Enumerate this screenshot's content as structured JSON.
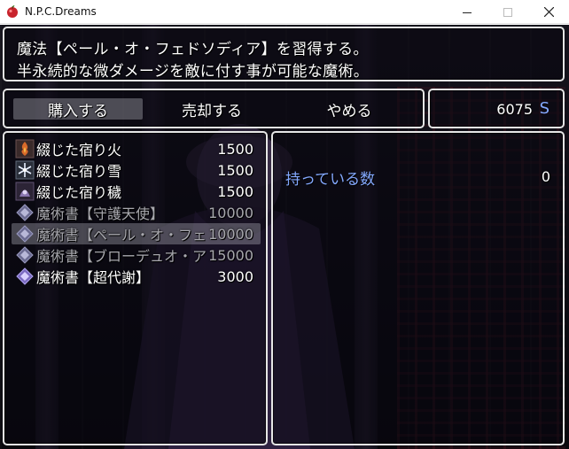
{
  "window": {
    "title": "N.P.C.Dreams",
    "icons": {
      "app": "apple-icon",
      "minimize": "minimize-icon",
      "maximize": "maximize-icon",
      "close": "close-icon"
    }
  },
  "help": {
    "line1": "魔法【ペール・オ・フェドソディア】を習得する。",
    "line2": "半永続的な微ダメージを敵に付す事が可能な魔術。"
  },
  "commands": {
    "buy": "購入する",
    "sell": "売却する",
    "cancel": "やめる"
  },
  "gold": {
    "amount": "6075",
    "unit": "S"
  },
  "items": [
    {
      "name": "綴じた宿り火",
      "price": "1500",
      "icon": "fire-charm-icon"
    },
    {
      "name": "綴じた宿り雪",
      "price": "1500",
      "icon": "snow-charm-icon"
    },
    {
      "name": "綴じた宿り穢",
      "price": "1500",
      "icon": "taint-charm-icon"
    },
    {
      "name": "魔術書【守護天使】",
      "price": "10000",
      "icon": "spellbook-icon"
    },
    {
      "name": "魔術書【ペール・オ・フェ",
      "price": "10000",
      "icon": "spellbook-icon"
    },
    {
      "name": "魔術書【ブローデュオ・ア",
      "price": "15000",
      "icon": "spellbook-icon"
    },
    {
      "name": "魔術書【超代謝】",
      "price": "3000",
      "icon": "spellbook-icon"
    }
  ],
  "status": {
    "owned_label": "持っている数",
    "owned_value": "0"
  },
  "colors": {
    "system_blue": "#84a9ff",
    "disabled_text": "#a8a8ae",
    "window_border": "#e6e6e6"
  }
}
